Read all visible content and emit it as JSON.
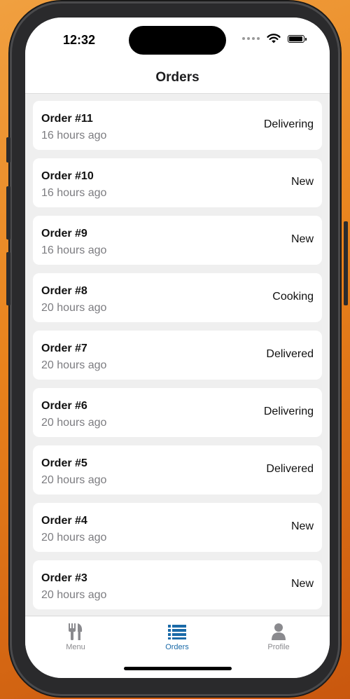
{
  "status_bar": {
    "time": "12:32"
  },
  "nav": {
    "title": "Orders"
  },
  "orders": [
    {
      "title": "Order #11",
      "time": "16 hours ago",
      "status": "Delivering"
    },
    {
      "title": "Order #10",
      "time": "16 hours ago",
      "status": "New"
    },
    {
      "title": "Order #9",
      "time": "16 hours ago",
      "status": "New"
    },
    {
      "title": "Order #8",
      "time": "20 hours ago",
      "status": "Cooking"
    },
    {
      "title": "Order #7",
      "time": "20 hours ago",
      "status": "Delivered"
    },
    {
      "title": "Order #6",
      "time": "20 hours ago",
      "status": "Delivering"
    },
    {
      "title": "Order #5",
      "time": "20 hours ago",
      "status": "Delivered"
    },
    {
      "title": "Order #4",
      "time": "20 hours ago",
      "status": "New"
    },
    {
      "title": "Order #3",
      "time": "20 hours ago",
      "status": "New"
    }
  ],
  "tabs": [
    {
      "label": "Menu",
      "icon": "fork-knife-icon",
      "active": false
    },
    {
      "label": "Orders",
      "icon": "list-icon",
      "active": true
    },
    {
      "label": "Profile",
      "icon": "person-icon",
      "active": false
    }
  ],
  "colors": {
    "accent": "#1a6aa8",
    "inactive": "#8a8a8e",
    "background": "#efefef"
  }
}
